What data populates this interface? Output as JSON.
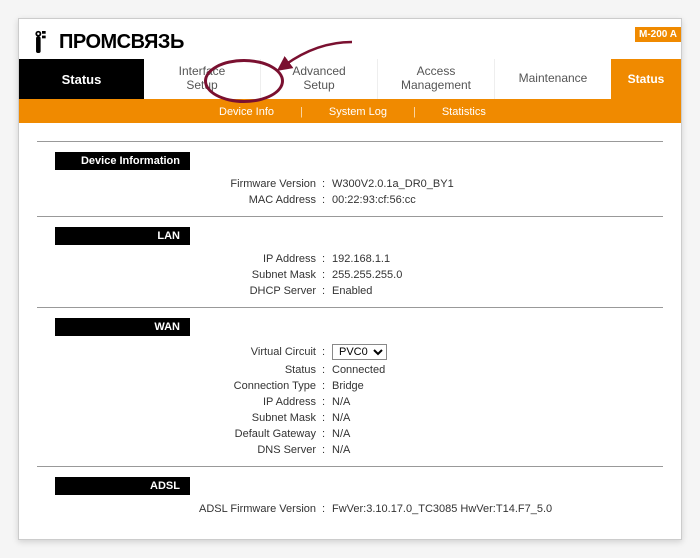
{
  "brand": "ПРОМСВЯЗЬ",
  "model_badge": "M-200 A",
  "nav": {
    "left_title": "Status",
    "tabs": [
      {
        "line1": "Interface",
        "line2": "Setup"
      },
      {
        "line1": "Advanced",
        "line2": "Setup"
      },
      {
        "line1": "Access",
        "line2": "Management"
      },
      {
        "line1": "Maintenance",
        "line2": ""
      }
    ],
    "right_title": "Status",
    "sub": [
      "Device Info",
      "System Log",
      "Statistics"
    ]
  },
  "sections": {
    "device_info": {
      "header": "Device Information",
      "firmware_label": "Firmware Version",
      "firmware_value": "W300V2.0.1a_DR0_BY1",
      "mac_label": "MAC Address",
      "mac_value": "00:22:93:cf:56:cc"
    },
    "lan": {
      "header": "LAN",
      "ip_label": "IP Address",
      "ip_value": "192.168.1.1",
      "mask_label": "Subnet Mask",
      "mask_value": "255.255.255.0",
      "dhcp_label": "DHCP Server",
      "dhcp_value": "Enabled"
    },
    "wan": {
      "header": "WAN",
      "vc_label": "Virtual Circuit",
      "vc_value": "PVC0",
      "status_label": "Status",
      "status_value": "Connected",
      "conn_label": "Connection Type",
      "conn_value": "Bridge",
      "ip_label": "IP Address",
      "ip_value": "N/A",
      "mask_label": "Subnet Mask",
      "mask_value": "N/A",
      "gw_label": "Default Gateway",
      "gw_value": "N/A",
      "dns_label": "DNS Server",
      "dns_value": "N/A"
    },
    "adsl": {
      "header": "ADSL",
      "fw_label": "ADSL Firmware Version",
      "fw_value": "FwVer:3.10.17.0_TC3085 HwVer:T14.F7_5.0"
    }
  }
}
